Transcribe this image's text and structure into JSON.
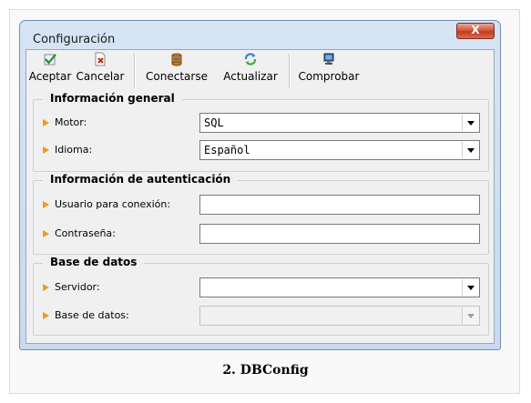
{
  "window": {
    "title": "Configuración",
    "close_label": "X"
  },
  "toolbar": {
    "buttons": [
      {
        "label": "Aceptar",
        "icon": "check-icon"
      },
      {
        "label": "Cancelar",
        "icon": "cancel-icon"
      },
      {
        "label": "Conectarse",
        "icon": "database-connect-icon"
      },
      {
        "label": "Actualizar",
        "icon": "refresh-icon"
      },
      {
        "label": "Comprobar",
        "icon": "monitor-icon"
      }
    ]
  },
  "groups": {
    "general": {
      "title": "Información general",
      "motor_label": "Motor:",
      "motor_value": "SQL",
      "idioma_label": "Idioma:",
      "idioma_value": "Español"
    },
    "auth": {
      "title": "Información de autenticación",
      "usuario_label": "Usuario para conexión:",
      "usuario_value": "",
      "password_label": "Contraseña:",
      "password_value": ""
    },
    "db": {
      "title": "Base de datos",
      "servidor_label": "Servidor:",
      "servidor_value": "",
      "basedatos_label": "Base de datos:",
      "basedatos_value": ""
    }
  },
  "caption": "2. DBConfig",
  "colors": {
    "arrow": "#f29a1c",
    "close_button": "#c23b22"
  }
}
